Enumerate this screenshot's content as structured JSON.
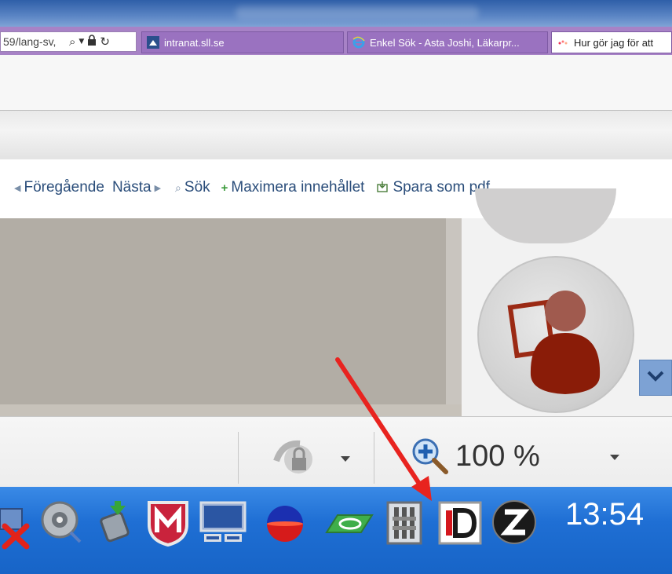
{
  "browser": {
    "address_text": "59/lang-sv,",
    "tabs": [
      {
        "label": "intranat.sll.se",
        "active": false
      },
      {
        "label": "Enkel Sök - Asta Joshi, Läkarpr...",
        "active": false
      },
      {
        "label": "Hur gör jag för att",
        "active": true
      }
    ]
  },
  "content_nav": {
    "items": [
      {
        "label": "Föregående",
        "icon": "triangle-left-icon"
      },
      {
        "label": "Nästa",
        "icon": "triangle-right-icon"
      },
      {
        "label": "Sök",
        "icon": "magnifier-icon"
      },
      {
        "label": "Maximera innehållet",
        "icon": "plus-icon"
      },
      {
        "label": "Spara som pdf",
        "icon": "save-pdf-icon"
      }
    ]
  },
  "status_bar": {
    "zoom": "100 %"
  },
  "taskbar": {
    "clock": "13:54",
    "tray_icons": [
      "network-disconnected-icon",
      "speaker-icon",
      "safely-remove-icon",
      "mcafee-icon",
      "display-icon",
      "colorball-icon",
      "nvidia-icon",
      "app-icon",
      "id-icon",
      "z-icon"
    ]
  },
  "colors": {
    "tab_bar": "#a782c6",
    "taskbar": "#1f6fd4",
    "annotation_arrow": "#e8231f"
  }
}
